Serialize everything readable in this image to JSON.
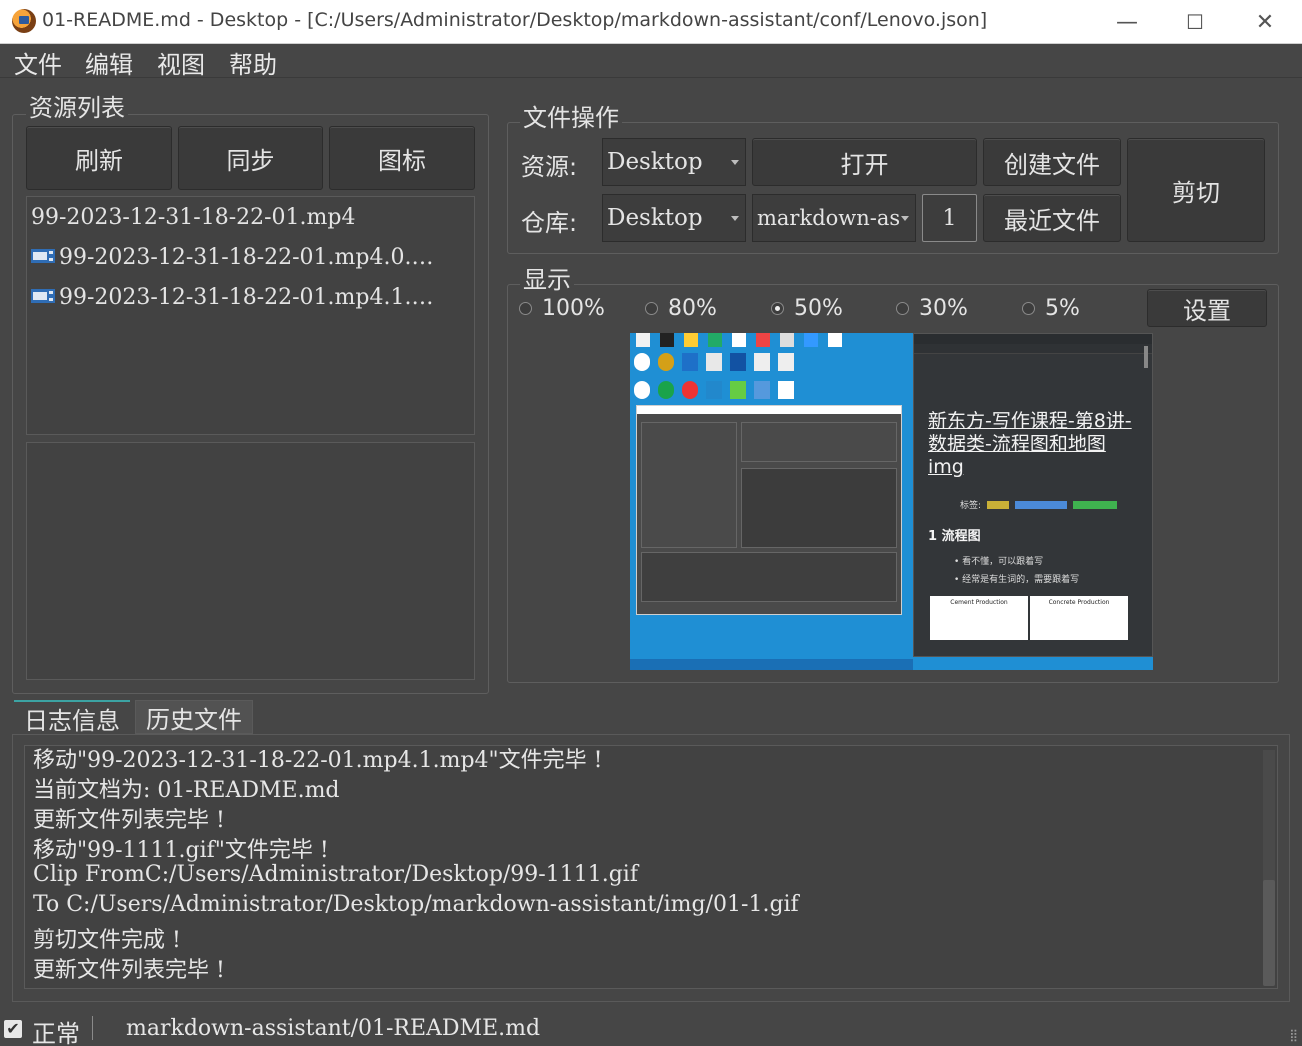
{
  "window": {
    "title": "01-README.md - Desktop - [C:/Users/Administrator/Desktop/markdown-assistant/conf/Lenovo.json]",
    "minimize": "—",
    "maximize": "☐",
    "close": "✕"
  },
  "menu": [
    "文件",
    "编辑",
    "视图",
    "帮助"
  ],
  "resources": {
    "title": "资源列表",
    "buttons": [
      "刷新",
      "同步",
      "图标"
    ],
    "files": [
      "99-2023-12-31-18-22-01.mp4",
      "99-2023-12-31-18-22-01.mp4.0.…",
      "99-2023-12-31-18-22-01.mp4.1.…"
    ]
  },
  "file_ops": {
    "title": "文件操作",
    "source_label": "资源:",
    "source_value": "Desktop",
    "repo_label": "仓库:",
    "repo_value": "Desktop",
    "repo_folder": "markdown-as",
    "spin_value": "1",
    "open": "打开",
    "create": "创建文件",
    "recent": "最近文件",
    "cut": "剪切"
  },
  "display": {
    "title": "显示",
    "options": [
      "100%",
      "80%",
      "50%",
      "30%",
      "5%"
    ],
    "selected": "50%",
    "settings": "设置"
  },
  "preview": {
    "article_title": "新东方-写作课程-第8讲-数据类-流程图和地图 img",
    "tags_label": "标签:",
    "section": "1 流程图",
    "bullets": [
      "看不懂，可以跟着写",
      "经常是有生词的，需要跟着写"
    ],
    "diagram_left": "Cement Production",
    "diagram_right": "Concrete Production"
  },
  "tabs": [
    "日志信息",
    "历史文件"
  ],
  "log": [
    "移动\"99-2023-12-31-18-22-01.mp4.1.mp4\"文件完毕 !",
    "当前文档为: 01-README.md",
    "更新文件列表完毕 !",
    "移动\"99-1111.gif\"文件完毕 !",
    "Clip FromC:/Users/Administrator/Desktop/99-1111.gif",
    "To C:/Users/Administrator/Desktop/markdown-assistant/img/01-1.gif",
    "剪切文件完成 !",
    "更新文件列表完毕 !"
  ],
  "status": {
    "state": "正常",
    "path": "markdown-assistant/01-README.md"
  }
}
